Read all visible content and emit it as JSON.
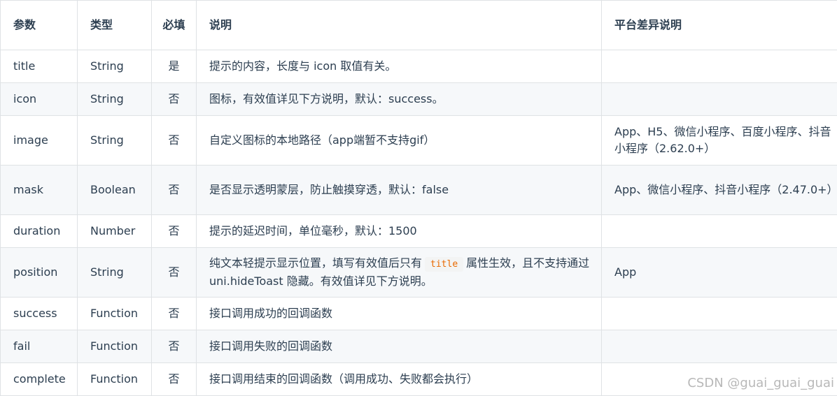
{
  "table": {
    "headers": {
      "param": "参数",
      "type": "类型",
      "required": "必填",
      "desc": "说明",
      "platform": "平台差异说明"
    },
    "rows": [
      {
        "param": "title",
        "type": "String",
        "required": "是",
        "desc": "提示的内容，长度与 icon 取值有关。",
        "platform": ""
      },
      {
        "param": "icon",
        "type": "String",
        "required": "否",
        "desc": "图标，有效值详见下方说明，默认：success。",
        "platform": ""
      },
      {
        "param": "image",
        "type": "String",
        "required": "否",
        "desc": "自定义图标的本地路径（app端暂不支持gif）",
        "platform": "App、H5、微信小程序、百度小程序、抖音小程序（2.62.0+）"
      },
      {
        "param": "mask",
        "type": "Boolean",
        "required": "否",
        "desc": "是否显示透明蒙层，防止触摸穿透，默认：false",
        "platform": "App、微信小程序、抖音小程序（2.47.0+）"
      },
      {
        "param": "duration",
        "type": "Number",
        "required": "否",
        "desc": "提示的延迟时间，单位毫秒，默认：1500",
        "platform": ""
      },
      {
        "param": "position",
        "type": "String",
        "required": "否",
        "desc_before": "纯文本轻提示显示位置，填写有效值后只有",
        "desc_code": "title",
        "desc_after": "属性生效，且不支持通过 uni.hideToast 隐藏。有效值详见下方说明。",
        "platform": "App"
      },
      {
        "param": "success",
        "type": "Function",
        "required": "否",
        "desc": "接口调用成功的回调函数",
        "platform": ""
      },
      {
        "param": "fail",
        "type": "Function",
        "required": "否",
        "desc": "接口调用失败的回调函数",
        "platform": ""
      },
      {
        "param": "complete",
        "type": "Function",
        "required": "否",
        "desc": "接口调用结束的回调函数（调用成功、失败都会执行）",
        "platform": ""
      }
    ]
  },
  "watermark": "CSDN @guai_guai_guai"
}
